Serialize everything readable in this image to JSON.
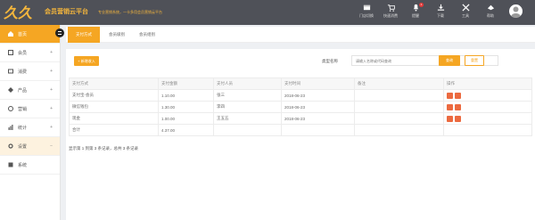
{
  "header": {
    "app_title": "会员营销云平台",
    "slogan": "专业营销系统，一卡多用会员营销云平台",
    "icons": [
      {
        "name": "store-icon",
        "label": "门店切换"
      },
      {
        "name": "cart-icon",
        "label": "快速消费",
        "badge": ""
      },
      {
        "name": "bell-icon",
        "label": "提醒",
        "badge": "1"
      },
      {
        "name": "download-icon",
        "label": "下载"
      },
      {
        "name": "tools-icon",
        "label": "工具"
      },
      {
        "name": "help-icon",
        "label": "帮助"
      }
    ]
  },
  "sidebar": {
    "items": [
      {
        "label": "首页",
        "icon": "home-icon",
        "state": "active"
      },
      {
        "label": "会员",
        "icon": "member-icon",
        "state": "normal"
      },
      {
        "label": "消费",
        "icon": "consume-icon",
        "state": "normal"
      },
      {
        "label": "产品",
        "icon": "product-icon",
        "state": "normal"
      },
      {
        "label": "营销",
        "icon": "marketing-icon",
        "state": "normal"
      },
      {
        "label": "统计",
        "icon": "stats-icon",
        "state": "normal"
      },
      {
        "label": "设置",
        "icon": "settings-icon",
        "state": "open"
      },
      {
        "label": "系统",
        "icon": "system-icon",
        "state": "sub"
      }
    ]
  },
  "tabs": [
    "支付方式",
    "会员级别",
    "会员组别"
  ],
  "toolbar": {
    "add_label": "+ 新增收入",
    "search_label": "类型名称",
    "search_placeholder": "请输入名称或代码查询",
    "search_button": "查询",
    "reset_button": "重置"
  },
  "table": {
    "headers": [
      "支付方式",
      "支付金额",
      "支付人员",
      "支付时间",
      "备注",
      "操作"
    ],
    "rows": [
      [
        "支付宝-会员",
        "1.10.00",
        "张三",
        "2018-06-23",
        "",
        ""
      ],
      [
        "微信钱包",
        "1.30.00",
        "李四",
        "2018-06-23",
        "",
        ""
      ],
      [
        "现金",
        "1.00.00",
        "王五五",
        "2018-06-23",
        "",
        ""
      ]
    ],
    "total_label": "合计",
    "total_value": "4.37.00"
  },
  "footer_note": "显示第 1 到第 3 条记录，总共 3 条记录",
  "colors": {
    "accent": "#f5a623",
    "topbar": "#4f5158",
    "danger": "#ec6a40"
  }
}
